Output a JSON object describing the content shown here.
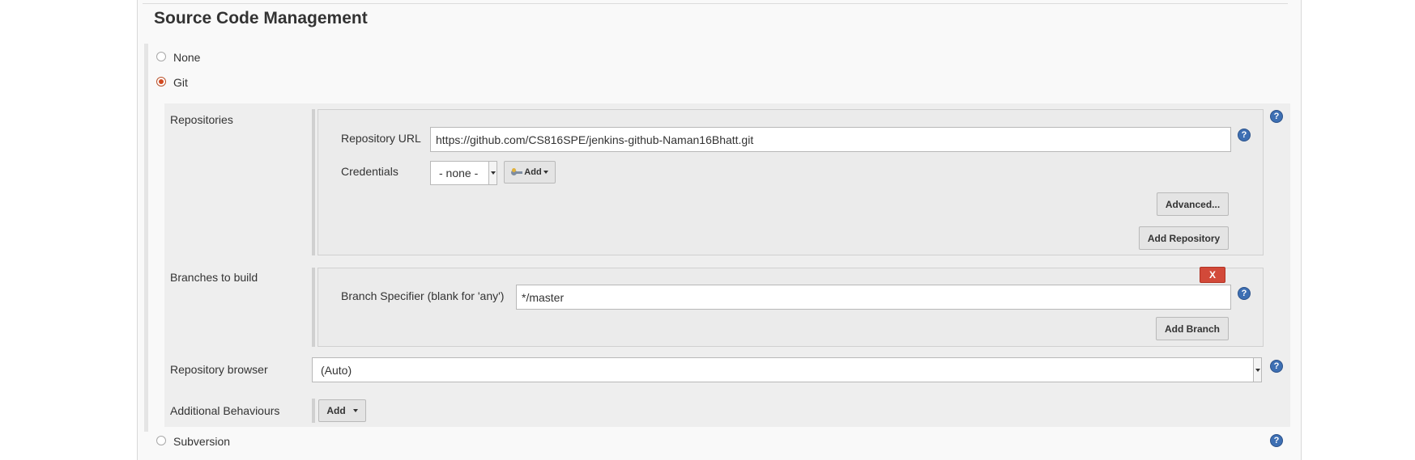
{
  "section": {
    "title": "Source Code Management"
  },
  "scm_options": {
    "none": "None",
    "git": "Git",
    "subversion": "Subversion"
  },
  "repositories": {
    "label": "Repositories",
    "url_label": "Repository URL",
    "url_value": "https://github.com/CS816SPE/jenkins-github-Naman16Bhatt.git",
    "credentials_label": "Credentials",
    "credentials_value": "- none -",
    "add_label": "Add",
    "advanced_label": "Advanced...",
    "add_repository_label": "Add Repository"
  },
  "branches": {
    "label": "Branches to build",
    "delete_label": "X",
    "specifier_label": "Branch Specifier (blank for 'any')",
    "specifier_value": "*/master",
    "add_branch_label": "Add Branch"
  },
  "repository_browser": {
    "label": "Repository browser",
    "value": "(Auto)"
  },
  "additional_behaviours": {
    "label": "Additional Behaviours",
    "add_label": "Add"
  },
  "help": {
    "glyph": "?"
  },
  "colors": {
    "delete_red": "#d24939",
    "radio_checked": "#d24920",
    "help_blue": "#3d6fb3"
  }
}
